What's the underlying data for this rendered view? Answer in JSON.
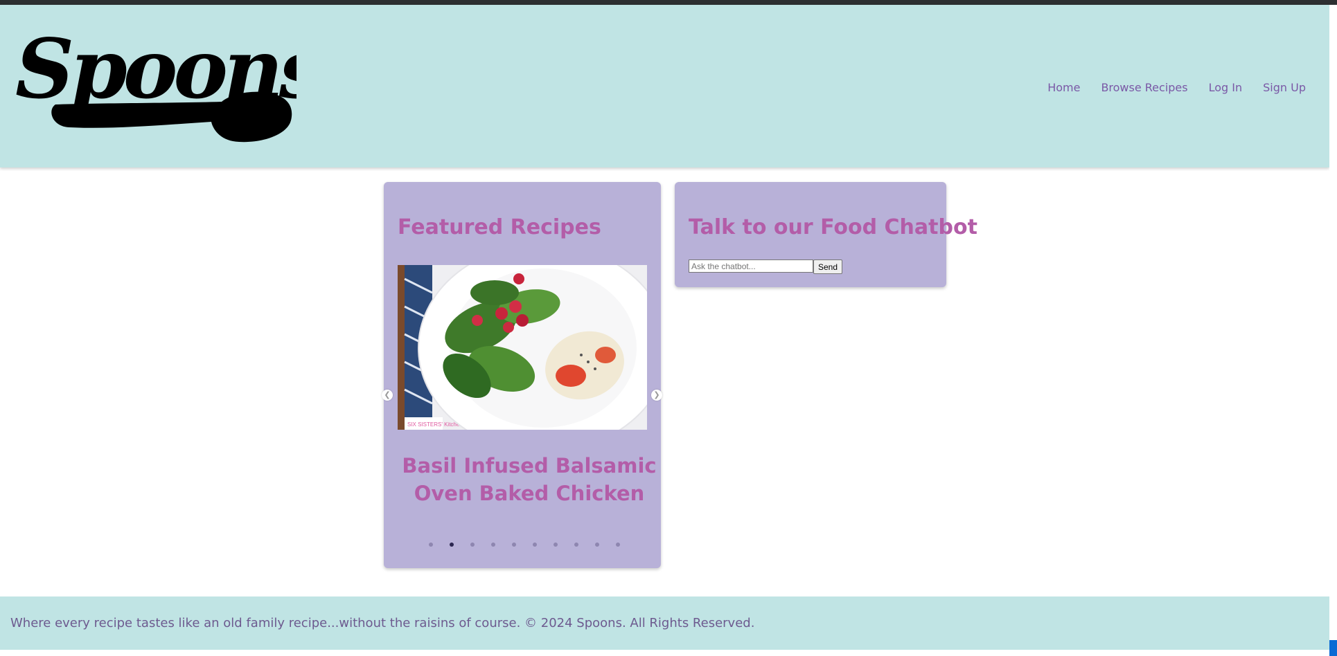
{
  "brand": {
    "name": "Spoons"
  },
  "nav": {
    "items": [
      "Home",
      "Browse Recipes",
      "Log In",
      "Sign Up"
    ]
  },
  "featured": {
    "title": "Featured Recipes",
    "recipe_title": "Basil Infused Balsamic Oven Baked Chicken",
    "slide_count": 10,
    "active_slide": 2,
    "image_watermark": "SIX SISTERS' Kitchen"
  },
  "chatbot": {
    "title": "Talk to our Food Chatbot",
    "input_placeholder": "Ask the chatbot...",
    "send_label": "Send"
  },
  "footer": {
    "text": "Where every recipe tastes like an old family recipe...without the raisins of course. © 2024 Spoons. All Rights Reserved."
  },
  "colors": {
    "header_bg": "#c0e4e4",
    "card_bg": "#b8b1d8",
    "accent": "#b35da8",
    "nav_link": "#7a58a6"
  }
}
